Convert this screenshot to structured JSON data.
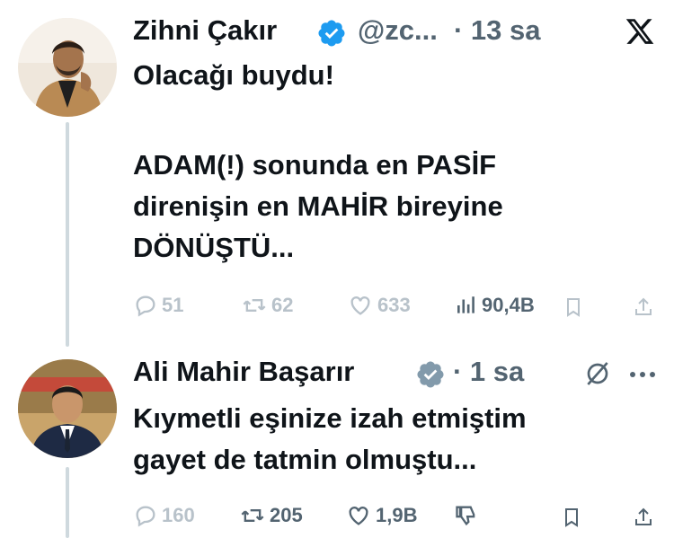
{
  "tweet1": {
    "author_name": "Zihni Çakır",
    "handle": "@zc...",
    "time": "· 13 sa",
    "text_line1": "Olacağı buydu!",
    "text_line2": "ADAM(!) sonunda en PASİF",
    "text_line3": "direnişin en MAHİR bireyine",
    "text_line4": "DÖNÜŞTÜ...",
    "replies": "51",
    "retweets": "62",
    "likes": "633",
    "views": "90,4B",
    "verified_color": "#1d9bf0"
  },
  "tweet2": {
    "author_name": "Ali Mahir Başarır",
    "time": "· 1 sa",
    "text_line1": "Kıymetli eşinize izah etmiştim",
    "text_line2": "gayet de tatmin olmuştu...",
    "replies": "160",
    "retweets": "205",
    "likes": "1,9B",
    "verified_color": "#829aab"
  },
  "icons": {
    "x_logo": "x-logo-icon",
    "grok": "grok-icon",
    "more": "more-icon"
  }
}
